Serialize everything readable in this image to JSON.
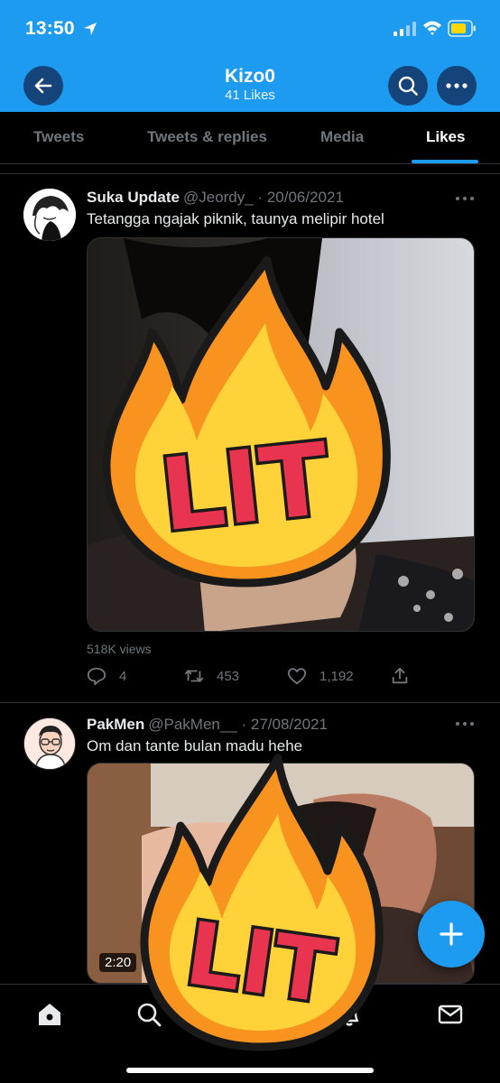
{
  "status_bar": {
    "time": "13:50"
  },
  "header": {
    "title": "Kizo0",
    "subtitle": "41 Likes"
  },
  "tabs": [
    {
      "label": "Tweets"
    },
    {
      "label": "Tweets & replies"
    },
    {
      "label": "Media"
    },
    {
      "label": "Likes"
    }
  ],
  "active_tab": "Likes",
  "tweets": [
    {
      "name": "Suka Update",
      "handle": "@Jeordy_ · 20/06/2021",
      "text": "Tetangga ngajak piknik, taunya melipir hotel",
      "views": "518K views",
      "replies": "4",
      "retweets": "453",
      "likes": "1,192",
      "sticker_text": "LIT"
    },
    {
      "name": "PakMen",
      "handle": "@PakMen__ · 27/08/2021",
      "text": "Om dan tante bulan madu hehe",
      "duration": "2:20",
      "sticker_text": "LIT"
    }
  ],
  "colors": {
    "accent": "#1d9bf0",
    "background": "#000000",
    "muted": "#71767b",
    "sticker_red": "#e8344e",
    "sticker_yellow": "#ffd23a",
    "sticker_orange": "#f7931e"
  },
  "icons": {
    "header": [
      "back-arrow-icon",
      "search-icon",
      "more-icon"
    ],
    "tweet_actions": [
      "reply-icon",
      "retweet-icon",
      "like-icon",
      "share-icon"
    ],
    "bottom_nav": [
      "home-icon",
      "explore-icon",
      "notifications-icon",
      "messages-icon"
    ],
    "fab": "compose-plus-icon"
  }
}
